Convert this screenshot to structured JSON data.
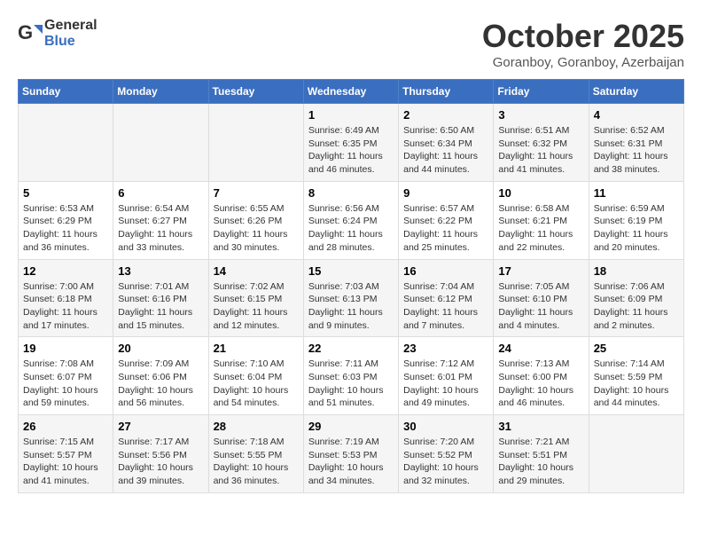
{
  "header": {
    "logo_line1": "General",
    "logo_line2": "Blue",
    "month": "October 2025",
    "location": "Goranboy, Goranboy, Azerbaijan"
  },
  "weekdays": [
    "Sunday",
    "Monday",
    "Tuesday",
    "Wednesday",
    "Thursday",
    "Friday",
    "Saturday"
  ],
  "weeks": [
    [
      {
        "day": "",
        "info": ""
      },
      {
        "day": "",
        "info": ""
      },
      {
        "day": "",
        "info": ""
      },
      {
        "day": "1",
        "info": "Sunrise: 6:49 AM\nSunset: 6:35 PM\nDaylight: 11 hours\nand 46 minutes."
      },
      {
        "day": "2",
        "info": "Sunrise: 6:50 AM\nSunset: 6:34 PM\nDaylight: 11 hours\nand 44 minutes."
      },
      {
        "day": "3",
        "info": "Sunrise: 6:51 AM\nSunset: 6:32 PM\nDaylight: 11 hours\nand 41 minutes."
      },
      {
        "day": "4",
        "info": "Sunrise: 6:52 AM\nSunset: 6:31 PM\nDaylight: 11 hours\nand 38 minutes."
      }
    ],
    [
      {
        "day": "5",
        "info": "Sunrise: 6:53 AM\nSunset: 6:29 PM\nDaylight: 11 hours\nand 36 minutes."
      },
      {
        "day": "6",
        "info": "Sunrise: 6:54 AM\nSunset: 6:27 PM\nDaylight: 11 hours\nand 33 minutes."
      },
      {
        "day": "7",
        "info": "Sunrise: 6:55 AM\nSunset: 6:26 PM\nDaylight: 11 hours\nand 30 minutes."
      },
      {
        "day": "8",
        "info": "Sunrise: 6:56 AM\nSunset: 6:24 PM\nDaylight: 11 hours\nand 28 minutes."
      },
      {
        "day": "9",
        "info": "Sunrise: 6:57 AM\nSunset: 6:22 PM\nDaylight: 11 hours\nand 25 minutes."
      },
      {
        "day": "10",
        "info": "Sunrise: 6:58 AM\nSunset: 6:21 PM\nDaylight: 11 hours\nand 22 minutes."
      },
      {
        "day": "11",
        "info": "Sunrise: 6:59 AM\nSunset: 6:19 PM\nDaylight: 11 hours\nand 20 minutes."
      }
    ],
    [
      {
        "day": "12",
        "info": "Sunrise: 7:00 AM\nSunset: 6:18 PM\nDaylight: 11 hours\nand 17 minutes."
      },
      {
        "day": "13",
        "info": "Sunrise: 7:01 AM\nSunset: 6:16 PM\nDaylight: 11 hours\nand 15 minutes."
      },
      {
        "day": "14",
        "info": "Sunrise: 7:02 AM\nSunset: 6:15 PM\nDaylight: 11 hours\nand 12 minutes."
      },
      {
        "day": "15",
        "info": "Sunrise: 7:03 AM\nSunset: 6:13 PM\nDaylight: 11 hours\nand 9 minutes."
      },
      {
        "day": "16",
        "info": "Sunrise: 7:04 AM\nSunset: 6:12 PM\nDaylight: 11 hours\nand 7 minutes."
      },
      {
        "day": "17",
        "info": "Sunrise: 7:05 AM\nSunset: 6:10 PM\nDaylight: 11 hours\nand 4 minutes."
      },
      {
        "day": "18",
        "info": "Sunrise: 7:06 AM\nSunset: 6:09 PM\nDaylight: 11 hours\nand 2 minutes."
      }
    ],
    [
      {
        "day": "19",
        "info": "Sunrise: 7:08 AM\nSunset: 6:07 PM\nDaylight: 10 hours\nand 59 minutes."
      },
      {
        "day": "20",
        "info": "Sunrise: 7:09 AM\nSunset: 6:06 PM\nDaylight: 10 hours\nand 56 minutes."
      },
      {
        "day": "21",
        "info": "Sunrise: 7:10 AM\nSunset: 6:04 PM\nDaylight: 10 hours\nand 54 minutes."
      },
      {
        "day": "22",
        "info": "Sunrise: 7:11 AM\nSunset: 6:03 PM\nDaylight: 10 hours\nand 51 minutes."
      },
      {
        "day": "23",
        "info": "Sunrise: 7:12 AM\nSunset: 6:01 PM\nDaylight: 10 hours\nand 49 minutes."
      },
      {
        "day": "24",
        "info": "Sunrise: 7:13 AM\nSunset: 6:00 PM\nDaylight: 10 hours\nand 46 minutes."
      },
      {
        "day": "25",
        "info": "Sunrise: 7:14 AM\nSunset: 5:59 PM\nDaylight: 10 hours\nand 44 minutes."
      }
    ],
    [
      {
        "day": "26",
        "info": "Sunrise: 7:15 AM\nSunset: 5:57 PM\nDaylight: 10 hours\nand 41 minutes."
      },
      {
        "day": "27",
        "info": "Sunrise: 7:17 AM\nSunset: 5:56 PM\nDaylight: 10 hours\nand 39 minutes."
      },
      {
        "day": "28",
        "info": "Sunrise: 7:18 AM\nSunset: 5:55 PM\nDaylight: 10 hours\nand 36 minutes."
      },
      {
        "day": "29",
        "info": "Sunrise: 7:19 AM\nSunset: 5:53 PM\nDaylight: 10 hours\nand 34 minutes."
      },
      {
        "day": "30",
        "info": "Sunrise: 7:20 AM\nSunset: 5:52 PM\nDaylight: 10 hours\nand 32 minutes."
      },
      {
        "day": "31",
        "info": "Sunrise: 7:21 AM\nSunset: 5:51 PM\nDaylight: 10 hours\nand 29 minutes."
      },
      {
        "day": "",
        "info": ""
      }
    ]
  ]
}
